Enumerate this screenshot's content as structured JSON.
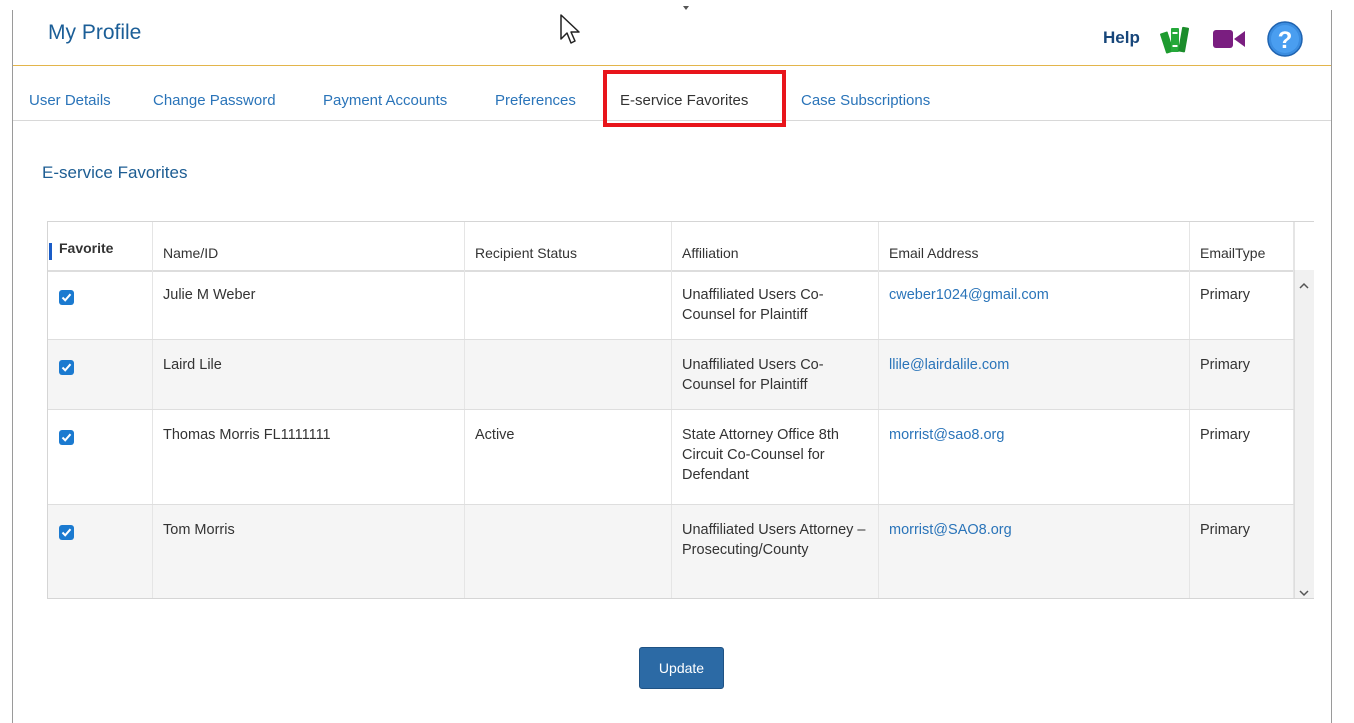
{
  "header": {
    "title": "My Profile",
    "help_label": "Help",
    "icons": {
      "books": "books-icon",
      "video": "video-camera-icon",
      "question": "question-icon"
    }
  },
  "tabs": [
    {
      "label": "User Details",
      "active": false
    },
    {
      "label": "Change Password",
      "active": false
    },
    {
      "label": "Payment Accounts",
      "active": false
    },
    {
      "label": "Preferences",
      "active": false
    },
    {
      "label": "E-service Favorites",
      "active": true
    },
    {
      "label": "Case Subscriptions",
      "active": false
    }
  ],
  "section": {
    "title": "E-service Favorites"
  },
  "table": {
    "columns": [
      "Favorite",
      "Name/ID",
      "Recipient Status",
      "Affiliation",
      "Email Address",
      "EmailType"
    ],
    "rows": [
      {
        "favorite": true,
        "name": "Julie M Weber",
        "status": "",
        "affiliation": "Unaffiliated Users Co-Counsel for Plaintiff",
        "email": "cweber1024@gmail.com",
        "type": "Primary"
      },
      {
        "favorite": true,
        "name": "Laird Lile",
        "status": "",
        "affiliation": "Unaffiliated Users Co-Counsel for Plaintiff",
        "email": "llile@lairdalile.com",
        "type": "Primary"
      },
      {
        "favorite": true,
        "name": "Thomas Morris FL1111111",
        "status": "Active",
        "affiliation": "State Attorney Office 8th Circuit Co-Counsel for Defendant",
        "email": "morrist@sao8.org",
        "type": "Primary"
      },
      {
        "favorite": true,
        "name": "Tom Morris",
        "status": "",
        "affiliation": "Unaffiliated Users Attorney – Prosecuting/County",
        "email": "morrist@SAO8.org",
        "type": "Primary"
      }
    ]
  },
  "actions": {
    "update_label": "Update"
  },
  "colors": {
    "brand_blue": "#1b5e97",
    "link_blue": "#2a74b9",
    "highlight_red": "#e8151b",
    "checkbox_blue": "#1b7ad0",
    "button_blue": "#2c6aa5"
  }
}
